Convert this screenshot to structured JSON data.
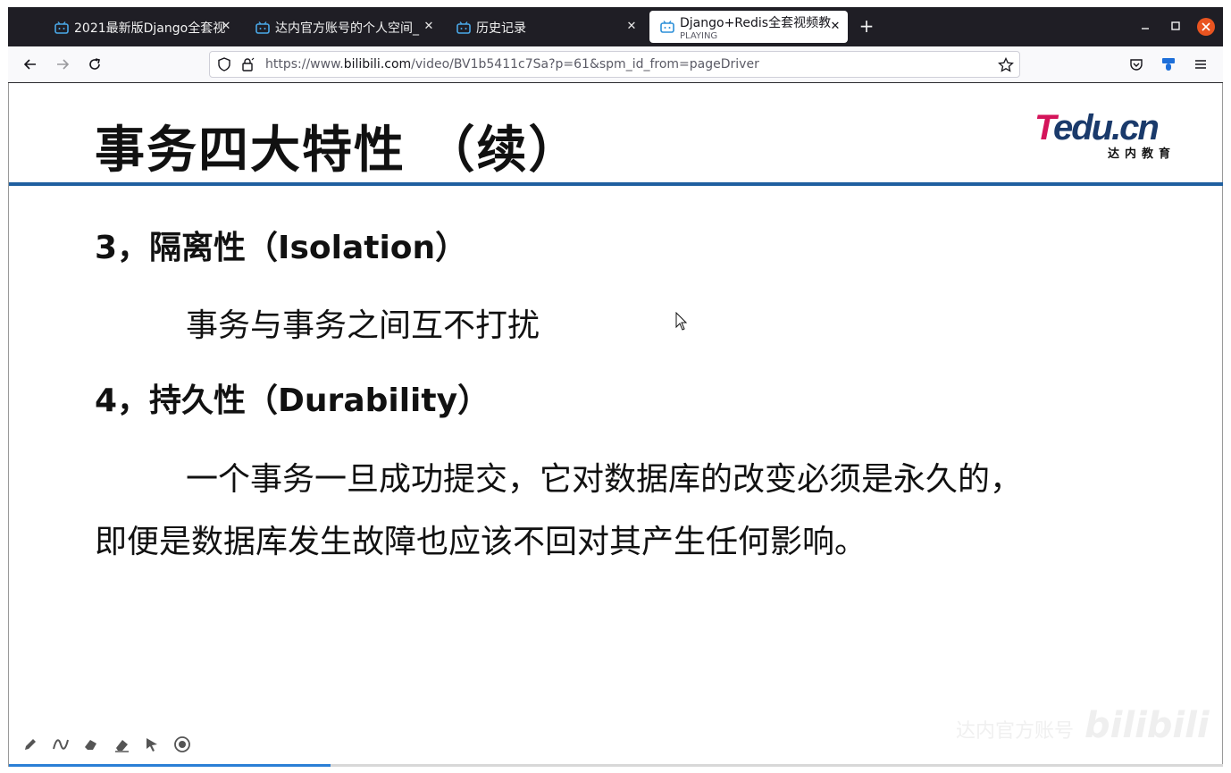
{
  "tabs": [
    {
      "title": "2021最新版Django全套视",
      "icon": "bilibili-icon"
    },
    {
      "title": "达内官方账号的个人空间_",
      "icon": "bilibili-icon"
    },
    {
      "title": "历史记录",
      "icon": "bilibili-icon"
    },
    {
      "title": "Django+Redis全套视频教",
      "subtitle": "PLAYING",
      "icon": "bilibili-icon",
      "active": true
    }
  ],
  "url": {
    "scheme": "https://www.",
    "host": "bilibili.com",
    "path": "/video/BV1b5411c7Sa?p=61&spm_id_from=pageDriver"
  },
  "slide": {
    "title": "事务四大特性 （续）",
    "logo_main_t": "T",
    "logo_main_rest": "edu.cn",
    "logo_sub": "达内教育",
    "heading_3": "3，隔离性（Isolation）",
    "text_3": "事务与事务之间互不打扰",
    "heading_4": "4，持久性（Durability）",
    "text_4_line1": "一个事务一旦成功提交，它对数据库的改变必须是永久的，",
    "text_4_line2": "即便是数据库发生故障也应该不回对其产生任何影响。"
  },
  "watermark": {
    "account": "达内官方账号",
    "brand": "bilibili"
  },
  "progress": {
    "fraction": 0.265
  },
  "colors": {
    "accent": "#2b7fd6",
    "rule": "#1f5fa0",
    "logo_red": "#d4145a",
    "logo_blue": "#1a3a6b",
    "close_button": "#e95420"
  }
}
